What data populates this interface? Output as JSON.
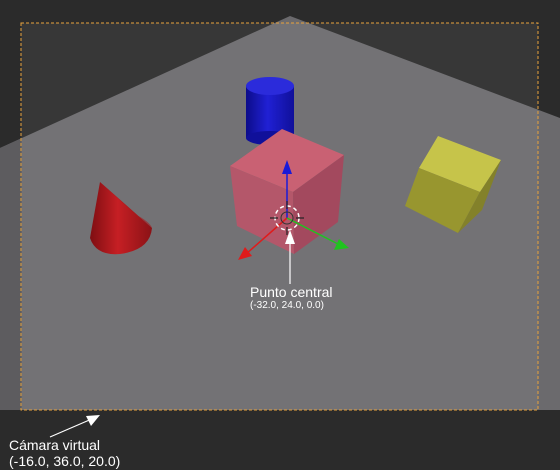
{
  "scene": {
    "pivot_point": {
      "label": "Punto central",
      "coordinates": "(-32.0, 24.0, 0.0)"
    },
    "virtual_camera": {
      "label": "Cámara virtual",
      "coordinates": "(-16.0, 36.0, 20.0)"
    },
    "objects": [
      {
        "name": "red-cone",
        "color": "#b0171b"
      },
      {
        "name": "blue-cylinder",
        "color": "#1a1ac0"
      },
      {
        "name": "pink-cube",
        "color": "#c96173"
      },
      {
        "name": "yellow-cube",
        "color": "#a8a63c"
      }
    ],
    "colors": {
      "background": "#2b2b2b",
      "ground_plane": "#6b6a6d",
      "camera_frame": "#e8a33c",
      "axis_x": "#e01b1b",
      "axis_y": "#1fc41f",
      "axis_z": "#1a1ad8",
      "annotation": "#ffffff"
    }
  }
}
